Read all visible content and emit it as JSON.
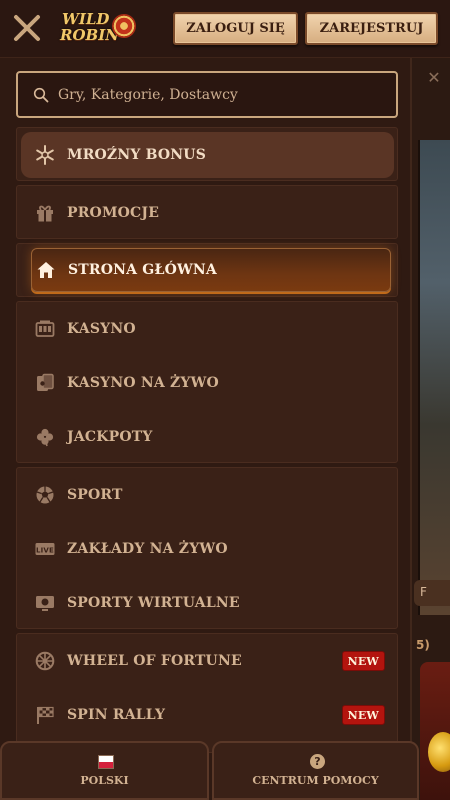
{
  "header": {
    "logo_line1": "WILD",
    "logo_line2": "ROBIN",
    "login_label": "ZALOGUJ SIĘ",
    "register_label": "ZAREJESTRUJ"
  },
  "search": {
    "placeholder": "Gry, Kategorie, Dostawcy"
  },
  "menu": {
    "bonus": "MROŹNY BONUS",
    "promotions": "PROMOCJE",
    "home": "STRONA GŁÓWNA",
    "casino": "KASYNO",
    "live_casino": "KASYNO NA ŻYWO",
    "jackpots": "JACKPOTY",
    "sport": "SPORT",
    "live_bets": "ZAKŁADY NA ŻYWO",
    "virtual_sports": "SPORTY WIRTUALNE",
    "wheel_of_fortune": "WHEEL OF FORTUNE",
    "spin_rally": "SPIN RALLY",
    "new_badge": "NEW"
  },
  "footer": {
    "language": "POLSKI",
    "help": "CENTRUM POMOCY"
  },
  "background": {
    "close_glyph": "✕",
    "chip_text": "F",
    "number_text": "5)"
  },
  "colors": {
    "background": "#2a1610",
    "panel": "#3a2117",
    "accent_border": "#c9a67e",
    "button_fill": "#e6c49a",
    "new_badge": "#b3140e",
    "active_item": "#6e3512"
  }
}
